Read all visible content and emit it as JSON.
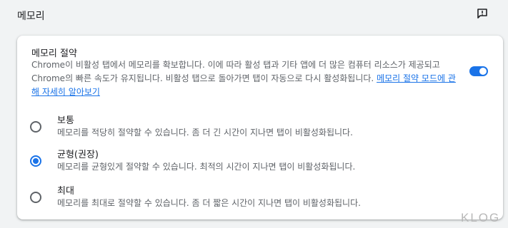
{
  "section": {
    "title": "메모리"
  },
  "memory_saver": {
    "title": "메모리 절약",
    "description": "Chrome이 비활성 탭에서 메모리를 확보합니다. 이에 따라 활성 탭과 기타 앱에 더 많은 컴퓨터 리소스가 제공되고 Chrome의 빠른 속도가 유지됩니다. 비활성 탭으로 돌아가면 탭이 자동으로 다시 활성화됩니다.",
    "learn_more_link": "메모리 절약 모드에 관해 자세히 알아보기",
    "enabled": true
  },
  "options": [
    {
      "label": "보통",
      "description": "메모리를 적당히 절약할 수 있습니다. 좀 더 긴 시간이 지나면 탭이 비활성화됩니다.",
      "selected": false
    },
    {
      "label": "균형(권장)",
      "description": "메모리를 균형있게 절약할 수 있습니다. 최적의 시간이 지나면 탭이 비활성화됩니다.",
      "selected": true
    },
    {
      "label": "최대",
      "description": "메모리를 최대로 절약할 수 있습니다. 좀 더 짧은 시간이 지나면 탭이 비활성화됩니다.",
      "selected": false
    }
  ],
  "icons": {
    "feedback": "feedback-icon"
  },
  "colors": {
    "accent": "#1a73e8",
    "background": "#f1f3f4",
    "card": "#ffffff"
  },
  "watermark": "KLOG"
}
